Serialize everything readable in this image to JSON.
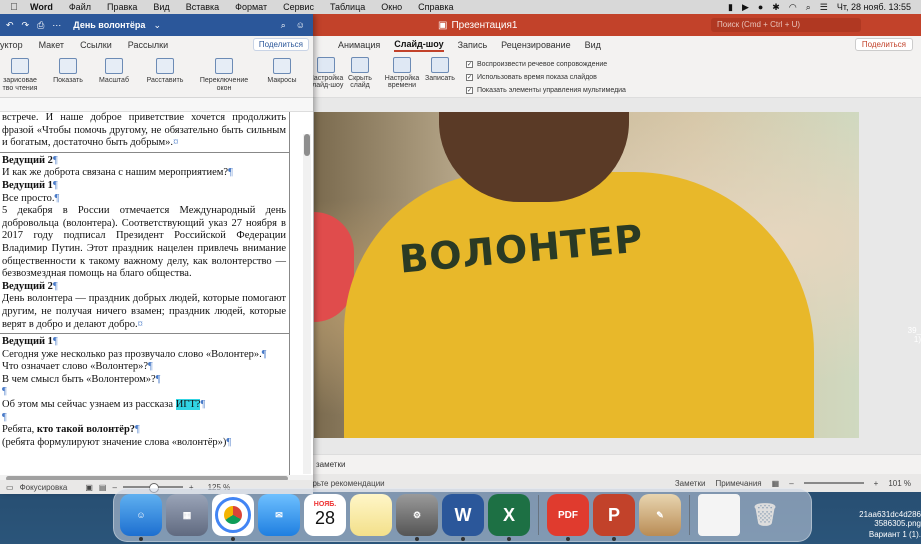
{
  "menubar": {
    "app_name": "Word",
    "items": [
      "Файл",
      "Правка",
      "Вид",
      "Вставка",
      "Формат",
      "Сервис",
      "Таблица",
      "Окно",
      "Справка"
    ],
    "clock": "Чт, 28 нояб.  13:55"
  },
  "word": {
    "doc_title": "День волонтёра",
    "tabs": [
      "уктор",
      "Макет",
      "Ссылки",
      "Рассылки"
    ],
    "share_label": "Поделиться",
    "ribbon": {
      "read_mode": "зарисовае\nтво чтения",
      "show": "Показать",
      "zoom": "Масштаб",
      "placement": "Расставить",
      "switch_windows": "Переключение\nокон",
      "macros": "Макросы"
    },
    "doc": {
      "p1": "встрече. И наше доброе приветствие хочется продолжить фразой «Чтобы помочь другому, не обязательно быть сильным и богатым, достаточно быть добрым».",
      "speaker2": "Ведущий 2",
      "q1": "И как же доброта связана с нашим мероприятием?",
      "speaker1": "Ведущий 1",
      "a1": "Все просто.",
      "p2": "5 декабря в России отмечается Международный день добровольца (волонтера). Соответствующий указ 27 ноября в 2017 году подписал Президент Российской Федерации Владимир Путин. Этот праздник нацелен привлечь внимание общественности к такому важному делу, как волонтерство — безвозмездная помощь на благо общества.",
      "speaker2b": "Ведущий 2",
      "p3": "День волонтера — праздник добрых людей, которые помогают другим, не получая ничего взамен; праздник людей, которые верят в добро и делают добро.",
      "speaker1b": "Ведущий 1",
      "l1": "Сегодня уже несколько раз прозвучало слово «Волонтер».",
      "l2": "Что означает слово «Волонтер»?",
      "l3": "В чем смысл быть «Волонтером»?",
      "l4_pre": "Об этом мы сейчас узнаем из рассказа ",
      "l4_hl": "ИГТ?",
      "l5_pre": "Ребята, ",
      "l5_bold": "кто такой волонтёр?",
      "l6": "(ребята формулируют значение слова «волонтёр»)"
    },
    "status": {
      "focus": "Фокусировка",
      "zoom": "125 %"
    }
  },
  "ppt": {
    "title": "Презентация1",
    "search_placeholder": "Поиск (Cmd + Ctrl + U)",
    "tabs": [
      "Анимация",
      "Слайд-шоу",
      "Запись",
      "Рецензирование",
      "Вид"
    ],
    "active_tab": "Слайд-шоу",
    "share_label": "Поделиться",
    "ribbon": {
      "setup": "Настройка\nслайд-шоу",
      "hide": "Скрыть\nслайд",
      "timing": "Настройка\nвремени",
      "record": "Записать"
    },
    "checks": [
      "Воспроизвести речевое сопровождение",
      "Использовать время показа слайдов",
      "Показать элементы управления мультимедиа"
    ],
    "slide_text": "ВОЛОНТЕР",
    "notes_placeholder": "заметки",
    "status": {
      "recommend": "ерьте рекомендации",
      "notes": "Заметки",
      "comments": "Примечания",
      "zoom": "101 %"
    }
  },
  "desktop": {
    "file1": "39_\n1)",
    "file2": "21aa631dc4d286\n3586305.png",
    "file3": "Вариант 1 (1)."
  },
  "dock": {
    "calendar_month": "НОЯБ.",
    "calendar_day": "28",
    "word_letter": "W",
    "excel_letter": "X",
    "pdf_label": "PDF",
    "ppt_letter": "P"
  },
  "colors": {
    "word_blue": "#2b579a",
    "ppt_red": "#c2422a",
    "shirt_yellow": "#e8b82a"
  }
}
